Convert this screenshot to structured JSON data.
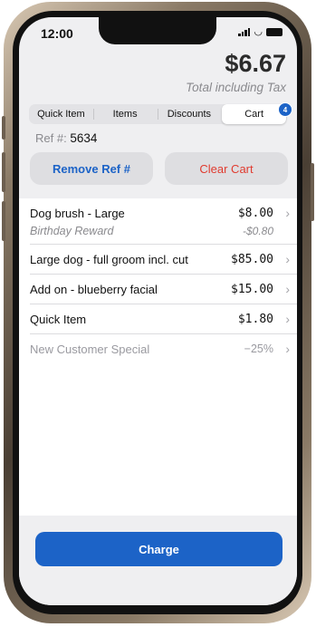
{
  "status": {
    "time": "12:00"
  },
  "header": {
    "total": "$6.67",
    "total_label": "Total including Tax"
  },
  "tabs": [
    {
      "label": "Quick Item",
      "active": false
    },
    {
      "label": "Items",
      "active": false
    },
    {
      "label": "Discounts",
      "active": false
    },
    {
      "label": "Cart",
      "active": true
    }
  ],
  "cart_badge": "4",
  "ref": {
    "label": "Ref #:",
    "value": "5634"
  },
  "buttons": {
    "remove_ref": "Remove Ref #",
    "clear_cart": "Clear Cart",
    "charge": "Charge"
  },
  "cart_items": [
    {
      "name": "Dog brush - Large",
      "price": "$8.00",
      "sub_name": "Birthday Reward",
      "sub_price": "-$0.80"
    },
    {
      "name": "Large dog - full groom incl. cut",
      "price": "$85.00"
    },
    {
      "name": "Add on - blueberry facial",
      "price": "$15.00"
    },
    {
      "name": "Quick Item",
      "price": "$1.80"
    },
    {
      "name": "New Customer Special",
      "price": "−25%"
    }
  ],
  "colors": {
    "accent": "#1c63c7",
    "destructive": "#e03b2f",
    "muted_text": "#8a8a8e"
  }
}
